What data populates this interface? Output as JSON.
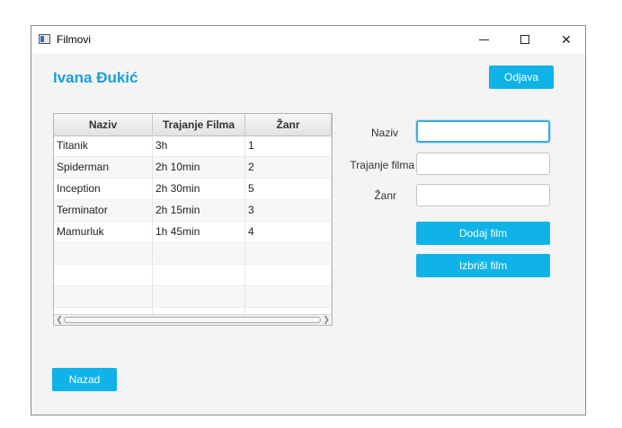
{
  "window": {
    "title": "Filmovi"
  },
  "header": {
    "user_name": "Ivana Đukić",
    "logout_label": "Odjava"
  },
  "table": {
    "columns": [
      "Naziv",
      "Trajanje Filma",
      "Žanr"
    ],
    "rows": [
      [
        "Titanik",
        "3h",
        "1"
      ],
      [
        "Spiderman",
        "2h 10min",
        "2"
      ],
      [
        "Inception",
        "2h 30min",
        "5"
      ],
      [
        "Terminator",
        "2h 15min",
        "3"
      ],
      [
        "Mamurluk",
        "1h 45min",
        "4"
      ]
    ]
  },
  "form": {
    "naziv_label": "Naziv",
    "naziv_value": "",
    "trajanje_label": "Trajanje filma",
    "trajanje_value": "",
    "zanr_label": "Žanr",
    "zanr_value": "",
    "add_label": "Dodaj film",
    "delete_label": "Izbriši film"
  },
  "footer": {
    "back_label": "Nazad"
  },
  "colors": {
    "accent": "#0fb3e8",
    "title_accent": "#1a9fd6"
  }
}
